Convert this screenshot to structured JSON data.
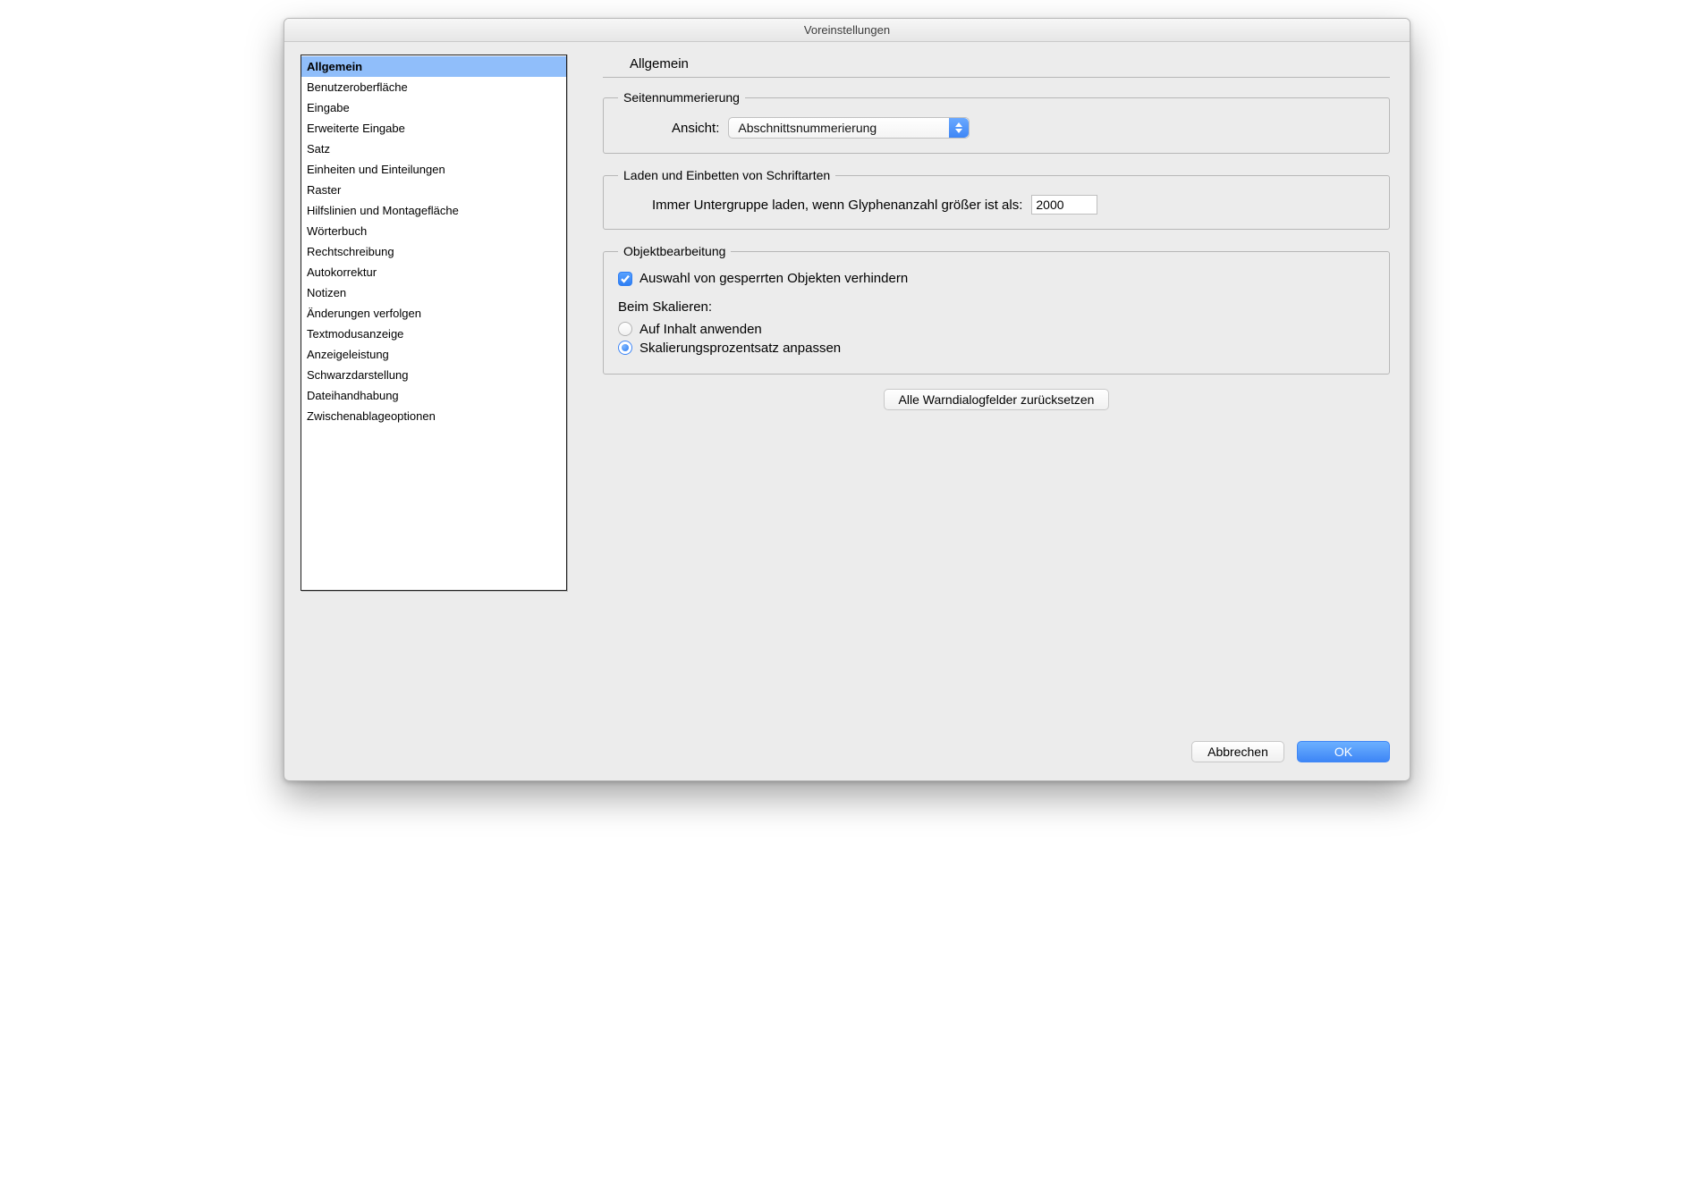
{
  "window": {
    "title": "Voreinstellungen"
  },
  "sidebar": {
    "selected_index": 0,
    "items": [
      "Allgemein",
      "Benutzeroberfläche",
      "Eingabe",
      "Erweiterte Eingabe",
      "Satz",
      "Einheiten und Einteilungen",
      "Raster",
      "Hilfslinien und Montagefläche",
      "Wörterbuch",
      "Rechtschreibung",
      "Autokorrektur",
      "Notizen",
      "Änderungen verfolgen",
      "Textmodusanzeige",
      "Anzeigeleistung",
      "Schwarzdarstellung",
      "Dateihandhabung",
      "Zwischenablageoptionen"
    ]
  },
  "main": {
    "title": "Allgemein",
    "page_numbering": {
      "legend": "Seitennummerierung",
      "view_label": "Ansicht:",
      "view_value": "Abschnittsnummerierung"
    },
    "fonts": {
      "legend": "Laden und Einbetten von Schriftarten",
      "subset_label": "Immer Untergruppe laden, wenn Glyphenanzahl größer ist als:",
      "subset_value": "2000"
    },
    "objects": {
      "legend": "Objektbearbeitung",
      "prevent_locked_label": "Auswahl von gesperrten Objekten verhindern",
      "prevent_locked_checked": true,
      "scaling_header": "Beim Skalieren:",
      "radio_apply_content": "Auf Inhalt anwenden",
      "radio_adjust_percent": "Skalierungsprozentsatz anpassen",
      "radio_selected": "adjust_percent"
    },
    "reset_button": "Alle Warndialogfelder zurücksetzen"
  },
  "footer": {
    "cancel": "Abbrechen",
    "ok": "OK"
  }
}
